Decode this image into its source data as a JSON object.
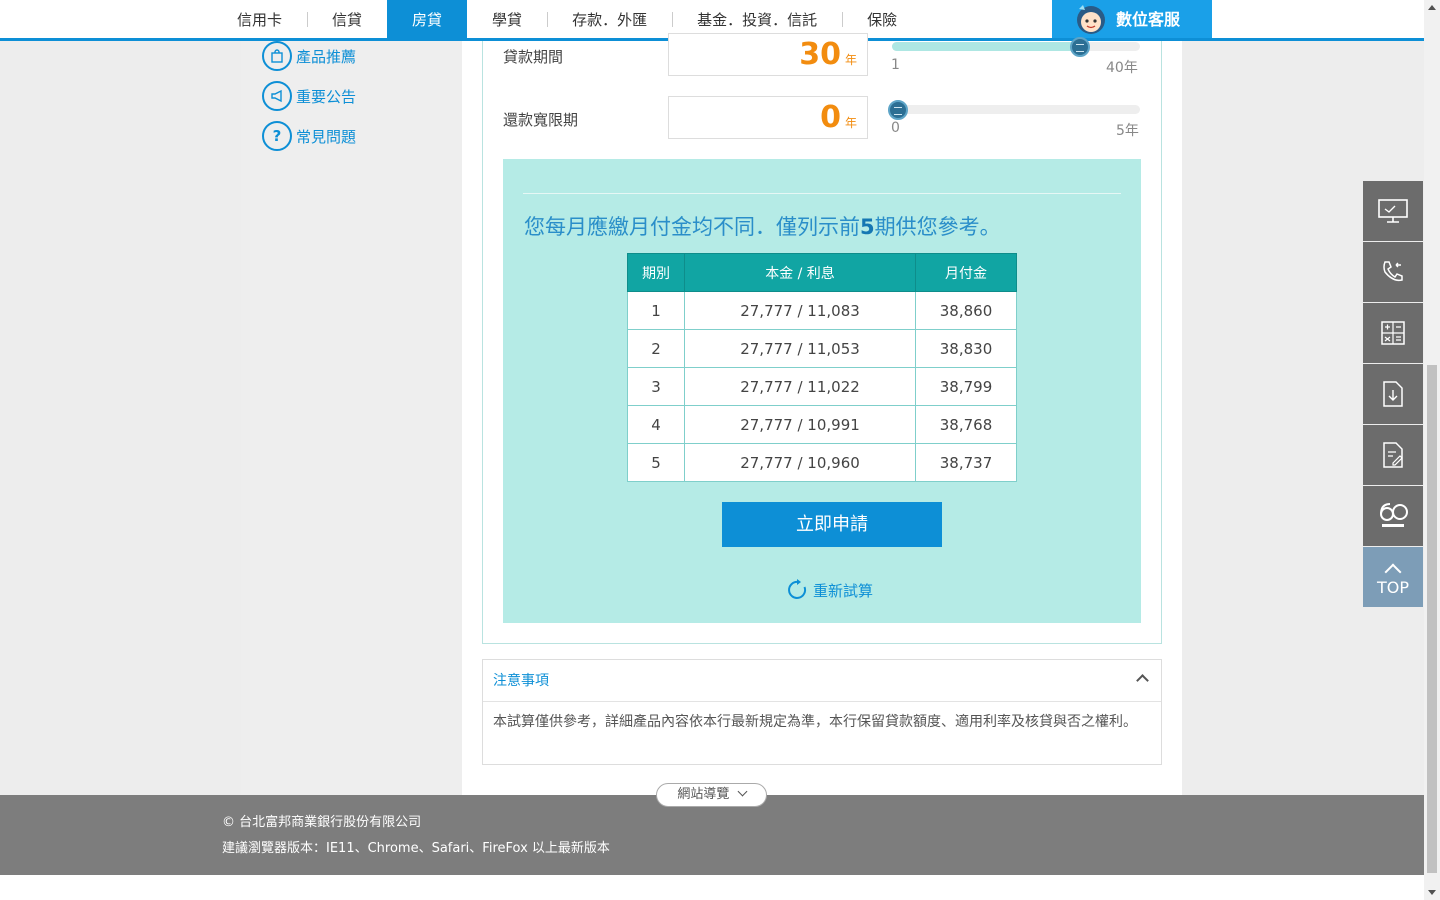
{
  "nav": {
    "items": [
      "信用卡",
      "信貸",
      "房貸",
      "學貸",
      "存款．外匯",
      "基金．投資．信託",
      "保險"
    ],
    "active_index": 2,
    "digital_service": "數位客服"
  },
  "sidebar": {
    "links": [
      "產品推薦",
      "重要公告",
      "常見問題"
    ]
  },
  "form": {
    "term": {
      "label": "貸款期間",
      "value": "30",
      "unit": "年",
      "min": "1",
      "max": "40年",
      "level": 0.76
    },
    "grace": {
      "label": "還款寬限期",
      "value": "0",
      "unit": "年",
      "min": "0",
      "max": "5年",
      "level": 0.0
    }
  },
  "result": {
    "title_pre": "您每月應繳月付金均不同．僅列示前",
    "title_num": "5",
    "title_post": "期供您參考。",
    "headers": [
      "期別",
      "本金 / 利息",
      "月付金"
    ],
    "rows": [
      [
        "1",
        "27,777 / 11,083",
        "38,860"
      ],
      [
        "2",
        "27,777 / 11,053",
        "38,830"
      ],
      [
        "3",
        "27,777 / 11,022",
        "38,799"
      ],
      [
        "4",
        "27,777 / 10,991",
        "38,768"
      ],
      [
        "5",
        "27,777 / 10,960",
        "38,737"
      ]
    ],
    "apply_label": "立即申請",
    "recalc_label": "重新試算"
  },
  "notes": {
    "title": "注意事項",
    "body": "本試算僅供參考，詳細產品內容依本行最新規定為準，本行保留貸款額度、適用利率及核貸與否之權利。"
  },
  "footer": {
    "sitemap": "網站導覽",
    "copyright": "© 台北富邦商業銀行股份有限公司",
    "browsers": "建議瀏覽器版本：IE11、Chrome、Safari、FireFox 以上最新版本"
  },
  "float_bar": {
    "top_label": "TOP"
  },
  "colors": {
    "brand_blue": "#0d8fd6",
    "accent_orange": "#f28c0f",
    "teal_panel": "#b5ebe6",
    "table_header": "#11a5a3"
  }
}
